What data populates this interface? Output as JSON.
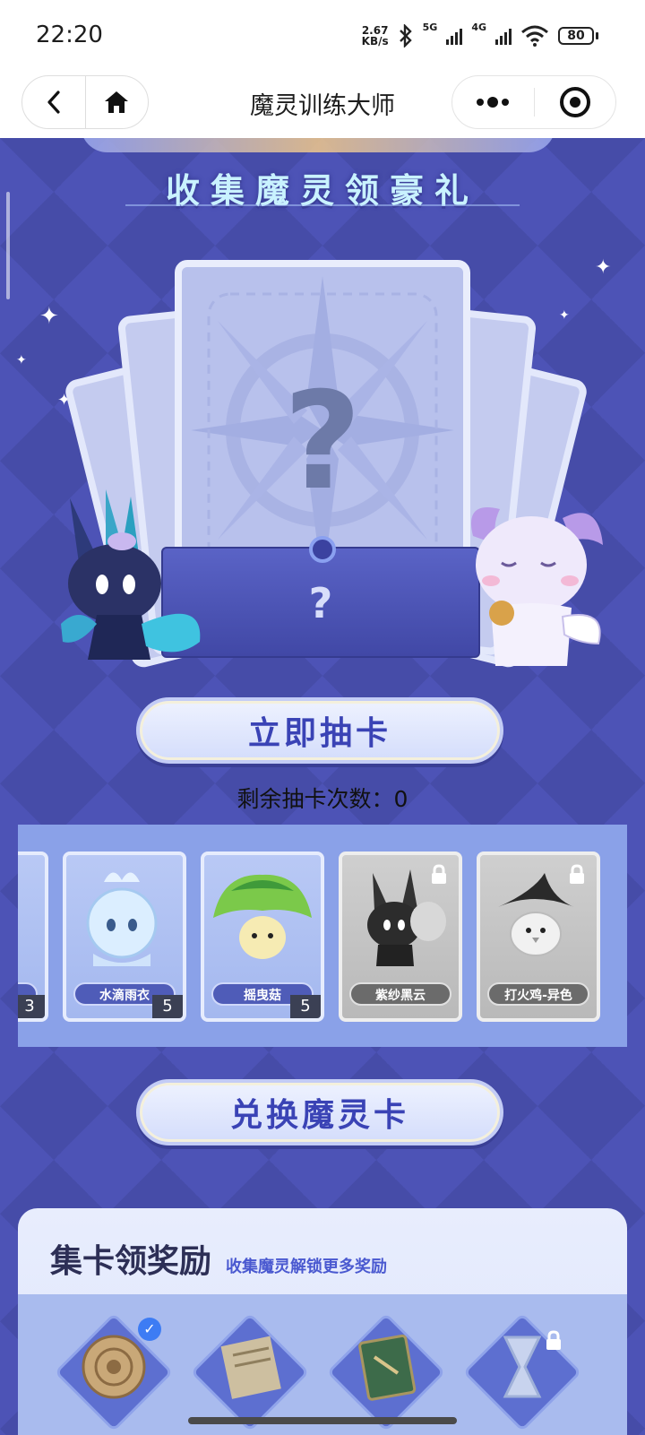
{
  "status_bar": {
    "time": "22:20",
    "net_speed_value": "2.67",
    "net_speed_unit": "KB/s",
    "signal_1_label": "5G",
    "signal_2_label": "4G",
    "battery": "80",
    "icons": [
      "bluetooth-icon",
      "signal-icon",
      "wifi-icon",
      "battery-icon"
    ]
  },
  "nav": {
    "title": "魔灵训练大师",
    "icons": [
      "back-icon",
      "home-icon",
      "more-icon",
      "target-icon"
    ]
  },
  "banner": {
    "subtitle": "收集魔灵领豪礼"
  },
  "draw_card": {
    "card_back_symbol": "?",
    "envelope_symbol": "?",
    "draw_button_label": "立即抽卡",
    "remaining_label": "剩余抽卡次数：",
    "remaining_count": "0"
  },
  "collection": {
    "cards": [
      {
        "name": "",
        "count": "3",
        "locked": false
      },
      {
        "name": "水滴雨衣",
        "count": "5",
        "locked": false
      },
      {
        "name": "摇曳菇",
        "count": "5",
        "locked": false
      },
      {
        "name": "紫纱黑云",
        "count": "",
        "locked": true
      },
      {
        "name": "打火鸡-异色",
        "count": "",
        "locked": true
      }
    ]
  },
  "exchange": {
    "button_label": "兑换魔灵卡"
  },
  "rewards": {
    "title": "集卡领奖励",
    "subtitle": "收集魔灵解锁更多奖励",
    "items": [
      {
        "icon": "shell-icon",
        "claimed": true,
        "locked": false
      },
      {
        "icon": "scroll-icon",
        "claimed": false,
        "locked": false
      },
      {
        "icon": "book-icon",
        "claimed": false,
        "locked": false
      },
      {
        "icon": "hourglass-icon",
        "claimed": false,
        "locked": true
      }
    ]
  },
  "colors": {
    "background": "#4a4fb2",
    "accent_text": "#3a43b5",
    "card_face": "#b8c1ec",
    "collection_strip": "#8aa1e8"
  }
}
